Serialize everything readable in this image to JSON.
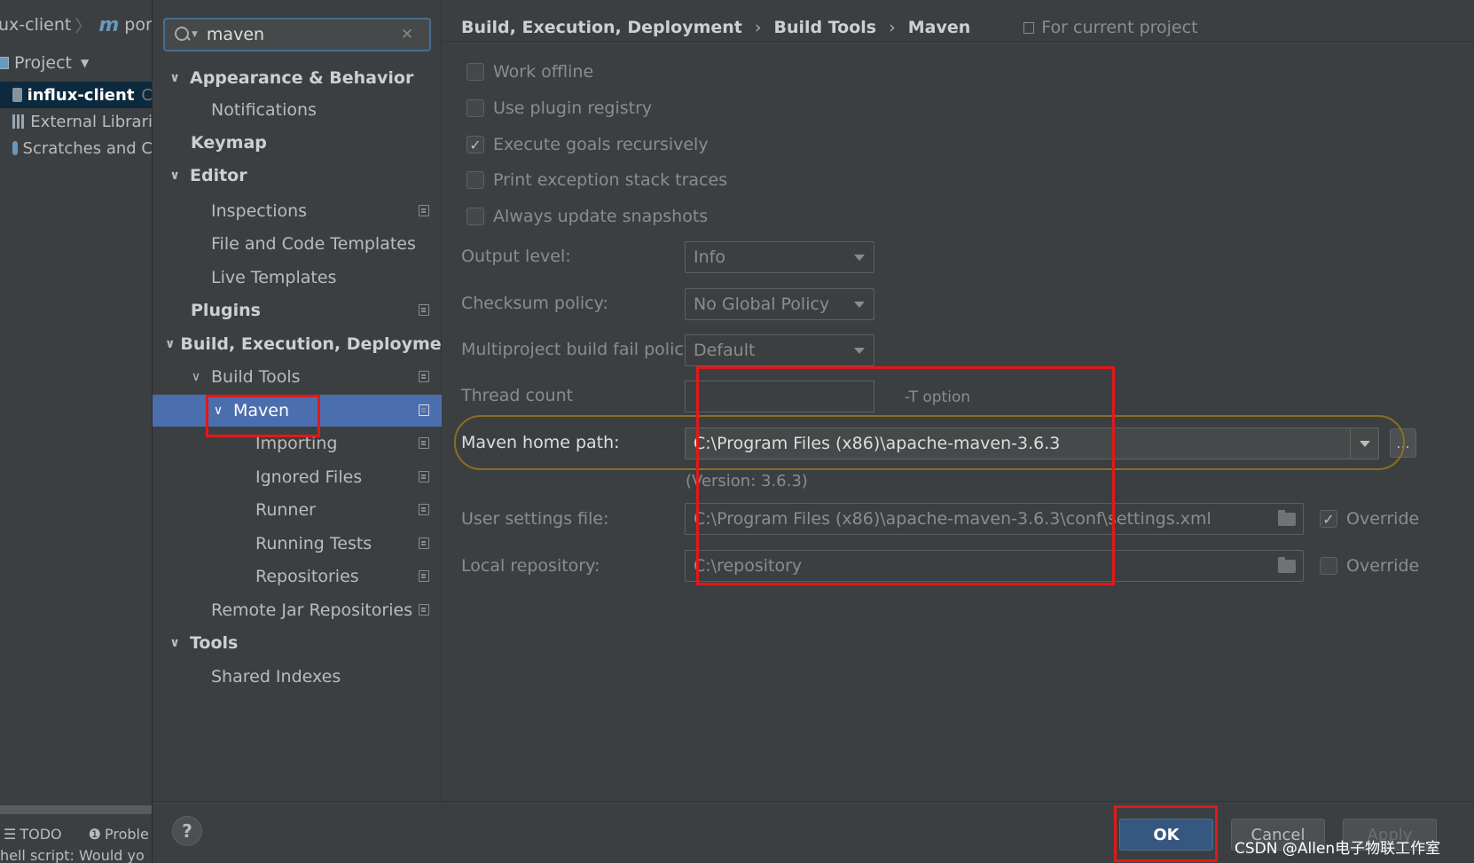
{
  "ide": {
    "crumb_project": "ux-client",
    "crumb_file": "pom.x",
    "project_header": "Project",
    "tree": [
      {
        "label": "influx-client",
        "suffix": "C"
      },
      {
        "label": "External Librari"
      },
      {
        "label": "Scratches and C"
      }
    ],
    "bottom_todo": "TODO",
    "bottom_problems": "Proble",
    "status_text": "hell script: Would yo"
  },
  "search": {
    "value": "maven"
  },
  "nav": {
    "appearance": "Appearance & Behavior",
    "notifications": "Notifications",
    "keymap": "Keymap",
    "editor": "Editor",
    "inspections": "Inspections",
    "file_code_templates": "File and Code Templates",
    "live_templates": "Live Templates",
    "plugins": "Plugins",
    "build_exec_deploy": "Build, Execution, Deployment",
    "build_tools": "Build Tools",
    "maven": "Maven",
    "importing": "Importing",
    "ignored_files": "Ignored Files",
    "runner": "Runner",
    "running_tests": "Running Tests",
    "repositories": "Repositories",
    "remote_jar_repos": "Remote Jar Repositories",
    "tools": "Tools",
    "shared_indexes": "Shared Indexes"
  },
  "breadcrumb": {
    "level1": "Build, Execution, Deployment",
    "level2": "Build Tools",
    "level3": "Maven",
    "scope": "For current project"
  },
  "options": {
    "work_offline": {
      "label": "Work offline",
      "checked": false
    },
    "use_plugin_registry": {
      "label": "Use plugin registry",
      "checked": false
    },
    "execute_goals_recursively": {
      "label": "Execute goals recursively",
      "checked": true
    },
    "print_exception_stack_traces": {
      "label": "Print exception stack traces",
      "checked": false
    },
    "always_update_snapshots": {
      "label": "Always update snapshots",
      "checked": false
    }
  },
  "fields": {
    "output_level_label": "Output level:",
    "output_level_value": "Info",
    "checksum_policy_label": "Checksum policy:",
    "checksum_policy_value": "No Global Policy",
    "multiproject_label": "Multiproject build fail policy:",
    "multiproject_value": "Default",
    "thread_count_label": "Thread count",
    "thread_count_value": "",
    "t_option": "-T option",
    "maven_home_label": "Maven home path:",
    "maven_home_value": "C:\\Program Files (x86)\\apache-maven-3.6.3",
    "browse": "...",
    "version": "(Version: 3.6.3)",
    "user_settings_label": "User settings file:",
    "user_settings_value": "C:\\Program Files (x86)\\apache-maven-3.6.3\\conf\\settings.xml",
    "user_settings_override": {
      "label": "Override",
      "checked": true
    },
    "local_repo_label": "Local repository:",
    "local_repo_value": "C:\\repository",
    "local_repo_override": {
      "label": "Override",
      "checked": false
    }
  },
  "buttons": {
    "help": "?",
    "ok": "OK",
    "cancel": "Cancel",
    "apply": "Apply"
  },
  "watermark": "CSDN @Allen电子物联工作室",
  "colors": {
    "selection": "#4b6eaf",
    "annotation_red": "#e01919",
    "ok_button": "#365880"
  }
}
